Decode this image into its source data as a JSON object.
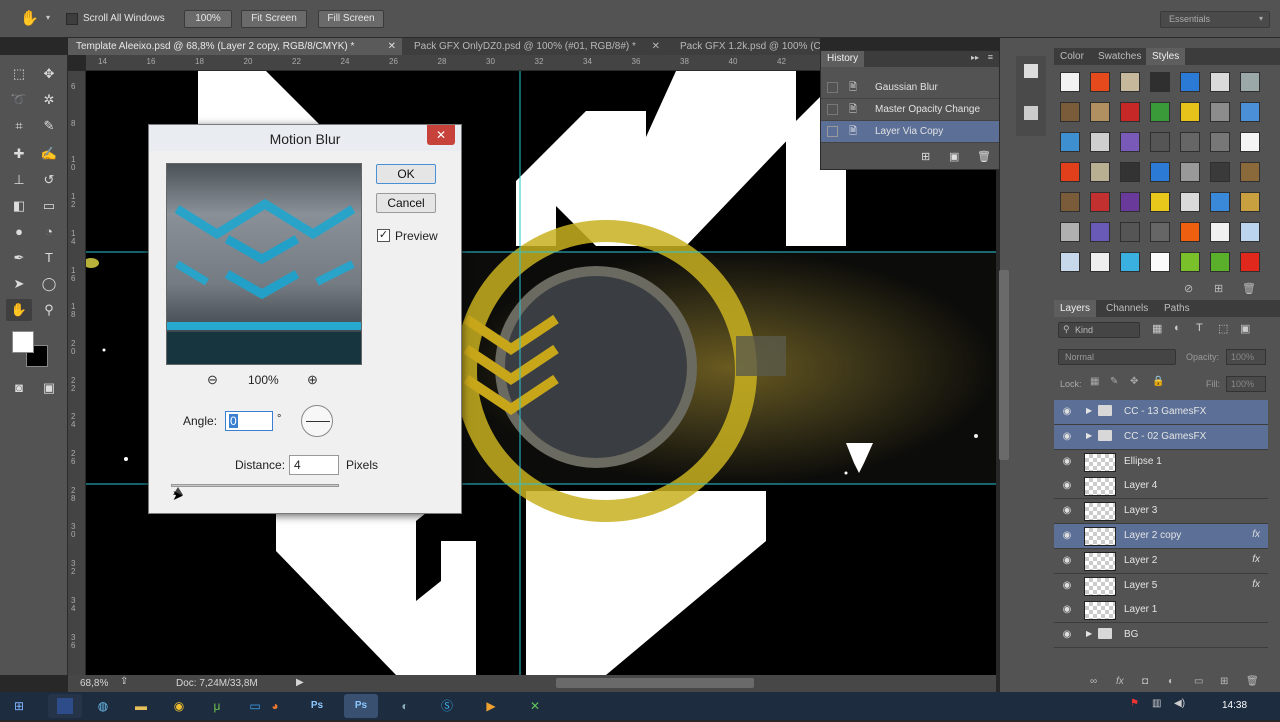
{
  "options_bar": {
    "scroll_all_windows": "Scroll All Windows",
    "zoom_100": "100%",
    "fit_screen": "Fit Screen",
    "fill_screen": "Fill Screen",
    "workspace": "Essentials"
  },
  "doc_tabs": [
    {
      "label": "Template Aleeixo.psd @ 68,8% (Layer 2 copy, RGB/8/CMYK) *"
    },
    {
      "label": "Pack GFX OnlyDZ0.psd @ 100% (#01, RGB/8#) *"
    },
    {
      "label": "Pack GFX 1.2k.psd @ 100% (CC - GamesFX, RGB/8#)"
    }
  ],
  "ruler_top": [
    "14",
    "16",
    "18",
    "20",
    "22",
    "24",
    "26",
    "28",
    "30",
    "32",
    "34",
    "36",
    "38",
    "40",
    "42",
    "44",
    "46",
    "48",
    "50"
  ],
  "ruler_left": [
    "6",
    "8",
    "1 0",
    "1 2",
    "1 4",
    "1 6",
    "1 8",
    "2 0",
    "2 2",
    "2 4",
    "2 6",
    "2 8",
    "3 0",
    "3 2",
    "3 4",
    "3 6"
  ],
  "status": {
    "zoom": "68,8%",
    "doc": "Doc: 7,24M/33,8M"
  },
  "history": {
    "title": "History",
    "items": [
      {
        "label": "Gaussian Blur"
      },
      {
        "label": "Master Opacity Change"
      },
      {
        "label": "Layer Via Copy"
      }
    ]
  },
  "styles_panel": {
    "tabs": [
      "Color",
      "Swatches",
      "Styles"
    ],
    "active": "Styles"
  },
  "layers_panel": {
    "tabs": [
      "Layers",
      "Channels",
      "Paths"
    ],
    "kind": "Kind",
    "blend": "Normal",
    "opacity_label": "Opacity:",
    "opacity_value": "100%",
    "lock_label": "Lock:",
    "fill_label": "Fill:",
    "fill_value": "100%",
    "layers": [
      {
        "name": "CC - 13 GamesFX",
        "group": true,
        "fx": false,
        "sel": true
      },
      {
        "name": "CC - 02 GamesFX",
        "group": true,
        "fx": false,
        "sel": true
      },
      {
        "name": "Ellipse 1",
        "group": false,
        "fx": false,
        "sel": false
      },
      {
        "name": "Layer 4",
        "group": false,
        "fx": false,
        "sel": false
      },
      {
        "name": "Layer 3",
        "group": false,
        "fx": false,
        "sel": false
      },
      {
        "name": "Layer 2 copy",
        "group": false,
        "fx": true,
        "sel": true
      },
      {
        "name": "Layer 2",
        "group": false,
        "fx": true,
        "sel": false
      },
      {
        "name": "Layer 5",
        "group": false,
        "fx": true,
        "sel": false
      },
      {
        "name": "Layer 1",
        "group": false,
        "fx": false,
        "sel": false
      },
      {
        "name": "BG",
        "group": true,
        "fx": false,
        "sel": false
      }
    ],
    "fx_label": "fx"
  },
  "dialog": {
    "title": "Motion Blur",
    "ok": "OK",
    "cancel": "Cancel",
    "preview_label": "Preview",
    "preview_checked": true,
    "zoom": "100%",
    "angle_label": "Angle:",
    "angle_value": "0",
    "degree": "°",
    "distance_label": "Distance:",
    "distance_value": "4",
    "pixels": "Pixels"
  },
  "taskbar": {
    "time": "14:38"
  }
}
